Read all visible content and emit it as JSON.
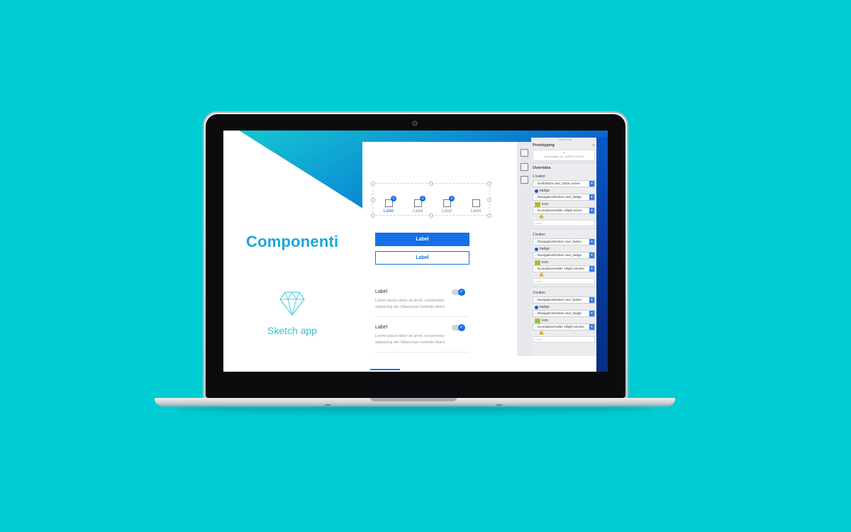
{
  "colors": {
    "background": "#00CCD3",
    "accent": "#1570E8",
    "title": "#1BA6D8"
  },
  "screen": {
    "title": "Componenti",
    "app_name": "Sketch app",
    "app_icon": "diamond-icon",
    "nav_items": [
      {
        "label": "Label",
        "badge": "1",
        "active": true
      },
      {
        "label": "Label",
        "badge": "1",
        "active": false
      },
      {
        "label": "Label",
        "badge": "1",
        "active": false
      },
      {
        "label": "Label",
        "badge": "",
        "active": false
      }
    ],
    "primary_button": "Label",
    "secondary_button": "Label",
    "list_items": [
      {
        "title": "Label",
        "description_line1": "Lorem ipsum dolor sit amet, consectetur",
        "description_line2": "adipiscing elit. Maecenas molestie libero"
      },
      {
        "title": "Label",
        "description_line1": "Lorem ipsum dolor sit amet, consectetur",
        "description_line2": "adipiscing elit. Maecenas molestie libero"
      }
    ]
  },
  "inspector": {
    "top_tabs": "Resize     Flip",
    "prototyping_title": "Prototyping",
    "prototyping_plus": "+",
    "proto_line1": "A",
    "proto_line2": "ui-kit-Master ta...ecTEXT+ICON",
    "overrides_title": "Overrides",
    "groups": [
      {
        "name": "1 button",
        "main": "...tion/bottom nav/_button active",
        "badge_label": "badge",
        "badge_value": ".../Navigation/bottom nav/_badge",
        "icon_label": "icon",
        "icon_value": ".../icons/placeholder 1/light active",
        "text_placeholder": "Label"
      },
      {
        "name": "2 button",
        "main": ".../Navigation/bottom nav/_button",
        "badge_label": "badge",
        "badge_value": ".../Navigation/bottom nav/_badge",
        "icon_label": "icon",
        "icon_value": ".../icons/placeholder 1/light inactive",
        "text_placeholder": "Label"
      },
      {
        "name": "3 button",
        "main": ".../Navigation/bottom nav/_button",
        "badge_label": "badge",
        "badge_value": ".../Navigation/bottom nav/_badge",
        "icon_label": "icon",
        "icon_value": ".../icons/placeholder 1/light inactive",
        "text_placeholder": "Label"
      }
    ]
  }
}
